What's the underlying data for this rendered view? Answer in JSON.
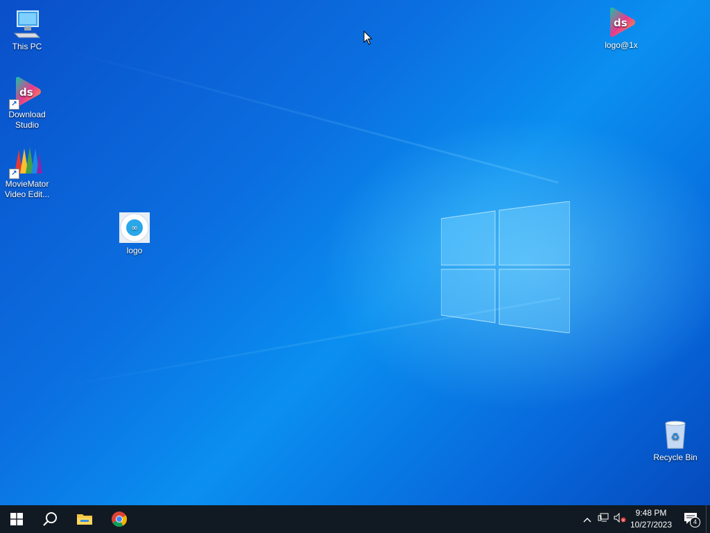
{
  "desktop": {
    "icons": [
      {
        "label": "This PC",
        "icon": "computer-icon"
      },
      {
        "label": "Download Studio",
        "icon": "download-studio-icon"
      },
      {
        "label": "MovieMator Video Edit...",
        "icon": "moviemator-icon"
      },
      {
        "label": "logo",
        "icon": "logo-icon"
      },
      {
        "label": "logo@1x",
        "icon": "download-studio-icon"
      },
      {
        "label": "Recycle Bin",
        "icon": "recycle-bin-icon"
      }
    ]
  },
  "taskbar": {
    "pinned": [
      {
        "name": "start-button",
        "icon": "windows-icon"
      },
      {
        "name": "search-button",
        "icon": "search-icon"
      },
      {
        "name": "file-explorer",
        "icon": "folder-icon"
      },
      {
        "name": "chrome",
        "icon": "chrome-icon"
      }
    ],
    "clock": {
      "time": "9:48 PM",
      "date": "10/27/2023"
    },
    "notification_count": "4"
  },
  "colors": {
    "taskbar_bg": "#111a22",
    "desktop_accent": "#0a8ff0"
  }
}
